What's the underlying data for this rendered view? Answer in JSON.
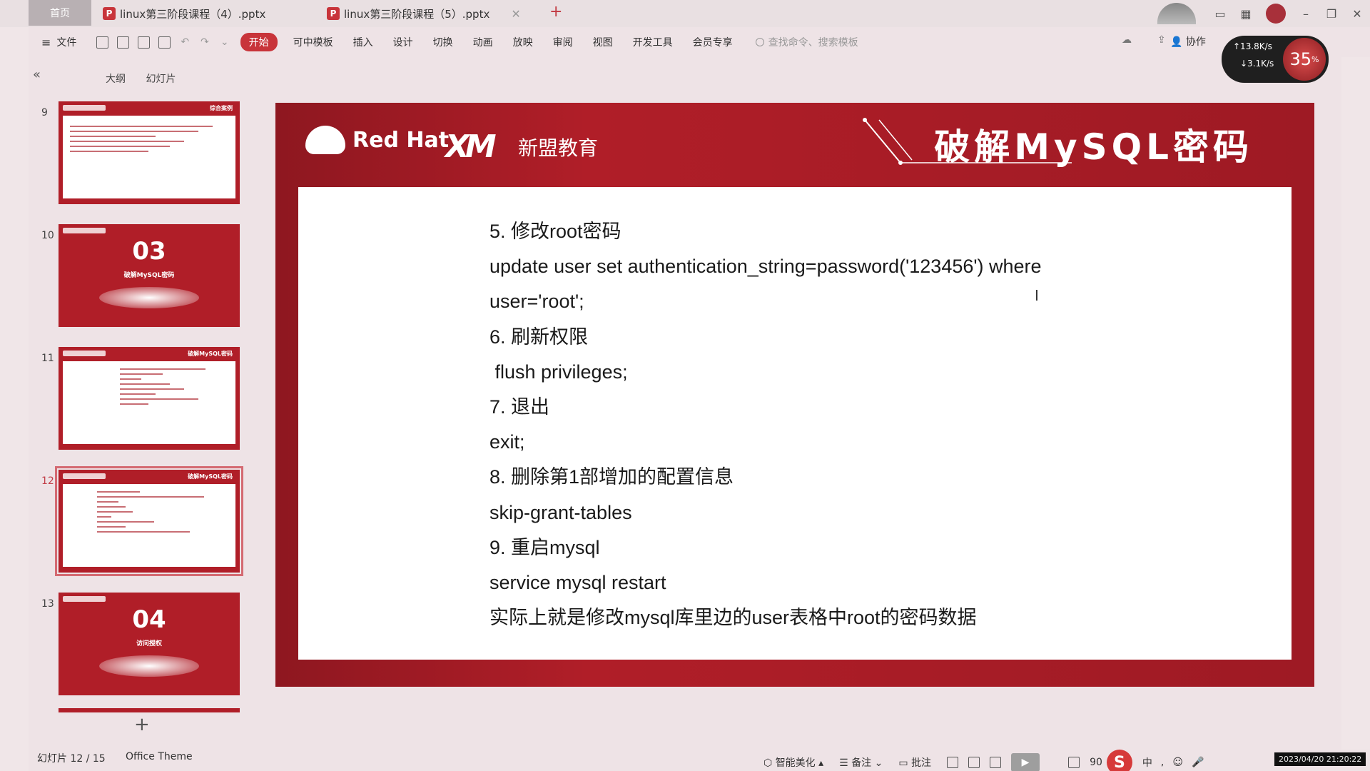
{
  "titlebar": {
    "home_label": "首页",
    "tabs": [
      {
        "title": "linux第三阶段课程（4）.pptx"
      },
      {
        "title": "linux第三阶段课程（5）.pptx"
      }
    ],
    "new_tab": "+"
  },
  "menubar": {
    "file": "文件",
    "items": [
      "开始",
      "可中模板",
      "插入",
      "设计",
      "切换",
      "动画",
      "放映",
      "审阅",
      "视图",
      "开发工具",
      "会员专享"
    ],
    "search_placeholder": "查找命令、搜索模板",
    "cooperate": "协作"
  },
  "network": {
    "up": "↑13.8K/s",
    "down": "↓3.1K/s",
    "percent": "35"
  },
  "left_panel": {
    "tabs": [
      "大纲",
      "幻灯片"
    ],
    "thumbnails": [
      {
        "num": "9",
        "kind": "text",
        "title": "综合案例"
      },
      {
        "num": "10",
        "kind": "section",
        "big": "03",
        "sub": "破解MySQL密码"
      },
      {
        "num": "11",
        "kind": "text",
        "title": "破解MySQL密码"
      },
      {
        "num": "12",
        "kind": "text",
        "title": "破解MySQL密码",
        "selected": true
      },
      {
        "num": "13",
        "kind": "section",
        "big": "04",
        "sub": "访问授权"
      }
    ]
  },
  "slide": {
    "brand_redhat": "Red Hat",
    "brand_xm": "XM",
    "brand_name": "新盟教育",
    "title": "破解MySQL密码",
    "lines": [
      "5. 修改root密码",
      "update user set authentication_string=password('123456') where",
      "user='root';",
      "6. 刷新权限",
      " flush privileges;",
      "7. 退出",
      "exit;",
      "8. 删除第1部增加的配置信息",
      "skip-grant-tables",
      "9. 重启mysql",
      "service mysql restart",
      "实际上就是修改mysql库里边的user表格中root的密码数据"
    ]
  },
  "statusbar": {
    "slide_count": "幻灯片 12 / 15",
    "theme": "Office Theme",
    "beautify": "智能美化",
    "notes": "备注",
    "comments": "批注",
    "zoom": "90",
    "clock": "2023/04/20 21:20:22"
  }
}
